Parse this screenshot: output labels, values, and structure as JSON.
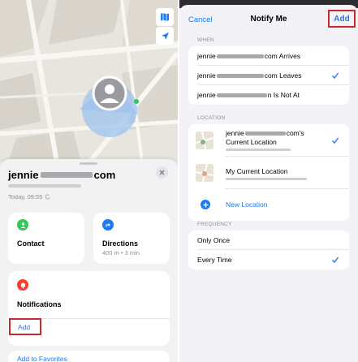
{
  "left": {
    "contact_name_start": "jennie",
    "contact_name_end": "com",
    "last_seen": "Today, 09:55",
    "contact_label": "Contact",
    "directions_label": "Directions",
    "directions_detail": "400 m • 3 min",
    "notifications_label": "Notifications",
    "add_label": "Add",
    "favorites_label": "Add to Favorites"
  },
  "right": {
    "cancel_label": "Cancel",
    "title": "Notify Me",
    "add_label": "Add",
    "when_header": "WHEN",
    "when_rows": [
      {
        "prefix": "jennie",
        "suffix": "com Arrives",
        "checked": false
      },
      {
        "prefix": "jennie",
        "suffix": "com Leaves",
        "checked": true
      },
      {
        "prefix": "jennie",
        "suffix": "n Is Not At",
        "checked": false
      }
    ],
    "location_header": "LOCATION",
    "location_rows": [
      {
        "line1_prefix": "jennie",
        "line1_suffix": "com's",
        "line2": "Current Location",
        "checked": true
      },
      {
        "line1": "My Current Location",
        "checked": false
      }
    ],
    "new_location_label": "New Location",
    "frequency_header": "FREQUENCY",
    "frequency_rows": [
      {
        "label": "Only Once",
        "checked": false
      },
      {
        "label": "Every Time",
        "checked": true
      }
    ]
  },
  "colors": {
    "accent_blue": "#1a7cf0",
    "contact_green": "#34c759",
    "notification_red": "#ff3b30",
    "highlight_red": "#c8282e"
  }
}
